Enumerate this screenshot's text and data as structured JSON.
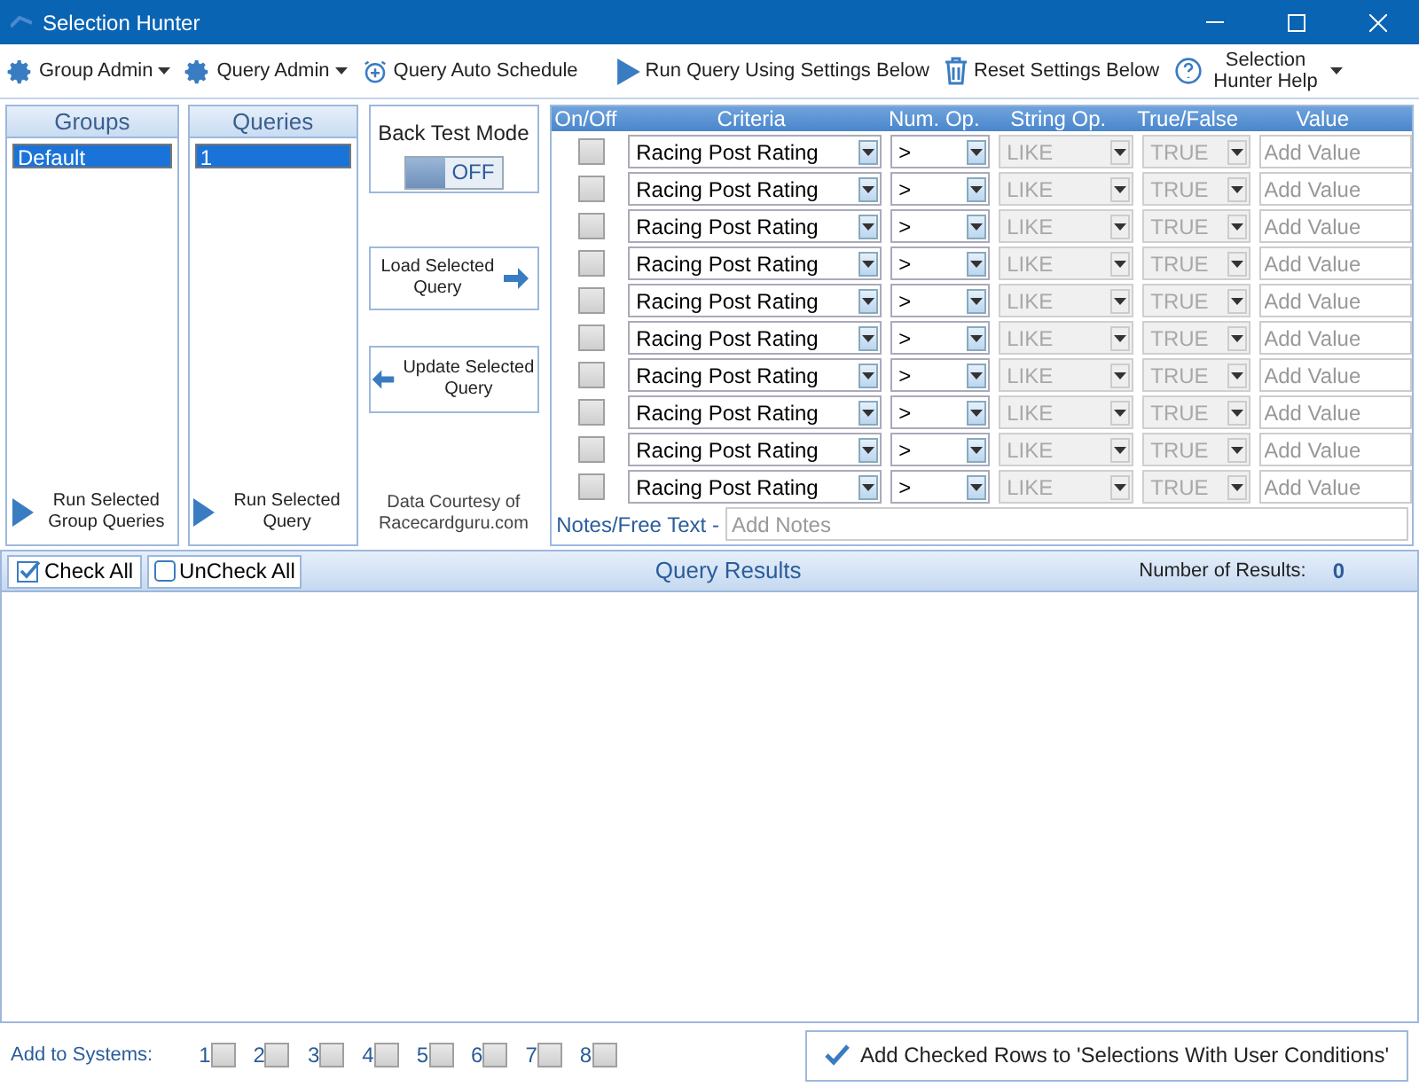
{
  "window": {
    "title": "Selection Hunter"
  },
  "toolbar": [
    {
      "kind": "gear",
      "label": "Group Admin",
      "dropdown": true
    },
    {
      "kind": "gear",
      "label": "Query Admin",
      "dropdown": true
    },
    {
      "kind": "clock",
      "label": "Query Auto Schedule",
      "dropdown": false
    },
    {
      "kind": "play",
      "label": "Run Query Using Settings Below",
      "dropdown": false
    },
    {
      "kind": "trash",
      "label": "Reset Settings Below",
      "dropdown": false
    },
    {
      "kind": "help",
      "label": "Selection Hunter Help",
      "dropdown": true
    }
  ],
  "groups": {
    "title": "Groups",
    "items": [
      {
        "label": "Default",
        "selected": true
      }
    ],
    "run_button": "Run Selected Group Queries"
  },
  "queries": {
    "title": "Queries",
    "items": [
      {
        "label": "1",
        "selected": true
      }
    ],
    "run_button": "Run Selected Query"
  },
  "back_test": {
    "label": "Back Test Mode",
    "on": false,
    "state_label": "OFF"
  },
  "load_button": "Load Selected Query",
  "update_button": "Update Selected Query",
  "credit": "Data Courtesy of Racecardguru.com",
  "criteria": {
    "columns": [
      "On/Off",
      "Criteria",
      "Num. Op.",
      "String Op.",
      "True/False",
      "Value"
    ],
    "rows": [
      {
        "checked": false,
        "criteria": "Racing Post Rating",
        "num_op": ">",
        "string_op": "LIKE",
        "true_false": "TRUE",
        "value_placeholder": "Add Value"
      },
      {
        "checked": false,
        "criteria": "Racing Post Rating",
        "num_op": ">",
        "string_op": "LIKE",
        "true_false": "TRUE",
        "value_placeholder": "Add Value"
      },
      {
        "checked": false,
        "criteria": "Racing Post Rating",
        "num_op": ">",
        "string_op": "LIKE",
        "true_false": "TRUE",
        "value_placeholder": "Add Value"
      },
      {
        "checked": false,
        "criteria": "Racing Post Rating",
        "num_op": ">",
        "string_op": "LIKE",
        "true_false": "TRUE",
        "value_placeholder": "Add Value"
      },
      {
        "checked": false,
        "criteria": "Racing Post Rating",
        "num_op": ">",
        "string_op": "LIKE",
        "true_false": "TRUE",
        "value_placeholder": "Add Value"
      },
      {
        "checked": false,
        "criteria": "Racing Post Rating",
        "num_op": ">",
        "string_op": "LIKE",
        "true_false": "TRUE",
        "value_placeholder": "Add Value"
      },
      {
        "checked": false,
        "criteria": "Racing Post Rating",
        "num_op": ">",
        "string_op": "LIKE",
        "true_false": "TRUE",
        "value_placeholder": "Add Value"
      },
      {
        "checked": false,
        "criteria": "Racing Post Rating",
        "num_op": ">",
        "string_op": "LIKE",
        "true_false": "TRUE",
        "value_placeholder": "Add Value"
      },
      {
        "checked": false,
        "criteria": "Racing Post Rating",
        "num_op": ">",
        "string_op": "LIKE",
        "true_false": "TRUE",
        "value_placeholder": "Add Value"
      },
      {
        "checked": false,
        "criteria": "Racing Post Rating",
        "num_op": ">",
        "string_op": "LIKE",
        "true_false": "TRUE",
        "value_placeholder": "Add Value"
      }
    ],
    "notes_label": "Notes/Free Text -",
    "notes_placeholder": "Add Notes"
  },
  "results": {
    "check_all": "Check All",
    "uncheck_all": "UnCheck All",
    "title": "Query Results",
    "count_label": "Number of Results:",
    "count": "0"
  },
  "bottom": {
    "label": "Add to Systems:",
    "systems": [
      {
        "label": "1",
        "checked": false
      },
      {
        "label": "2",
        "checked": false
      },
      {
        "label": "3",
        "checked": false
      },
      {
        "label": "4",
        "checked": false
      },
      {
        "label": "5",
        "checked": false
      },
      {
        "label": "6",
        "checked": false
      },
      {
        "label": "7",
        "checked": false
      },
      {
        "label": "8",
        "checked": false
      }
    ],
    "add_button": "Add Checked Rows to 'Selections With User Conditions'"
  }
}
